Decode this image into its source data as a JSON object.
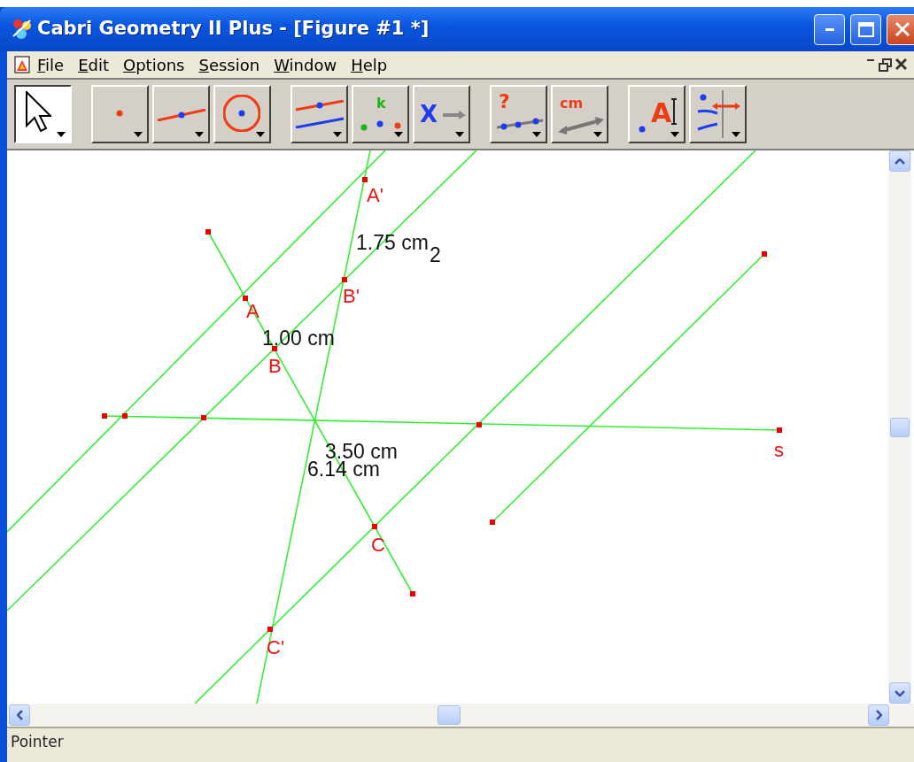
{
  "window": {
    "title": "Cabri Geometry II Plus - [Figure #1 *]"
  },
  "menu": [
    "File",
    "Edit",
    "Options",
    "Session",
    "Window",
    "Help"
  ],
  "toolbar": {
    "groups": [
      {
        "tools": [
          {
            "kind": "pointer",
            "selected": true
          }
        ]
      },
      {
        "tools": [
          {
            "kind": "point",
            "selected": false
          },
          {
            "kind": "line",
            "selected": false
          },
          {
            "kind": "circle",
            "selected": false
          }
        ]
      },
      {
        "tools": [
          {
            "kind": "parallel",
            "selected": false
          },
          {
            "kind": "points",
            "selected": false,
            "glyph": "k"
          },
          {
            "kind": "transform",
            "selected": false,
            "glyph": "X"
          }
        ]
      },
      {
        "tools": [
          {
            "kind": "check",
            "selected": false,
            "glyph": "?"
          },
          {
            "kind": "measure",
            "selected": false,
            "glyph": "cm"
          }
        ]
      },
      {
        "tools": [
          {
            "kind": "text",
            "selected": false,
            "glyph": "A"
          },
          {
            "kind": "attributes",
            "selected": false
          }
        ]
      }
    ]
  },
  "canvas": {
    "labels": [
      {
        "text": "A'",
        "kind": "point"
      },
      {
        "text": "1.75 cm",
        "kind": "measure"
      },
      {
        "text": "2",
        "kind": "measure"
      },
      {
        "text": "B'",
        "kind": "point"
      },
      {
        "text": "A",
        "kind": "point"
      },
      {
        "text": "1.00 cm",
        "kind": "measure"
      },
      {
        "text": "B",
        "kind": "point"
      },
      {
        "text": "3.50 cm",
        "kind": "measure"
      },
      {
        "text": "s",
        "kind": "point"
      },
      {
        "text": "6.14 cm",
        "kind": "measure"
      },
      {
        "text": "C",
        "kind": "point"
      },
      {
        "text": "C'",
        "kind": "point"
      }
    ]
  },
  "status_bar": "Pointer"
}
